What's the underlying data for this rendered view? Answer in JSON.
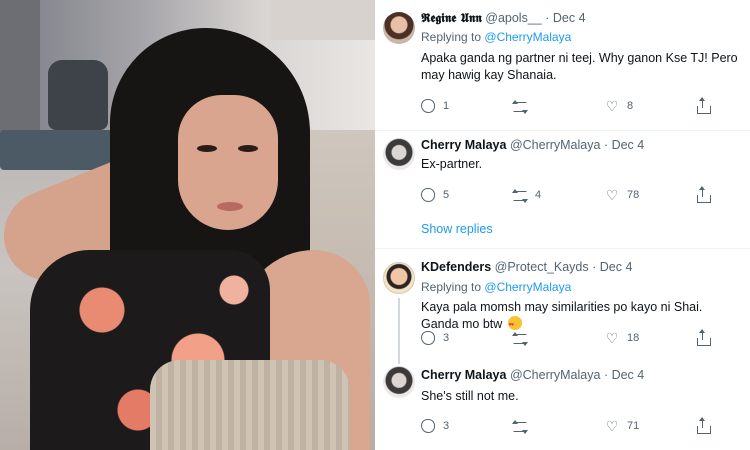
{
  "photo": {
    "description_icon": "portrait-photo"
  },
  "tweets": [
    {
      "name": "𝕽𝖊𝖌𝖎𝖓𝖊 𝖀𝖓𝖓",
      "handle": "@apols__",
      "date": "· Dec 4",
      "replying_label": "Replying to",
      "replying_handle": "@CherryMalaya",
      "text": "Apaka ganda ng partner ni teej. Why ganon Kse TJ! Pero may hawig kay Shanaia.",
      "replies": "1",
      "retweets": "",
      "likes": "8"
    },
    {
      "name": "Cherry Malaya",
      "handle": "@CherryMalaya",
      "date": "· Dec 4",
      "text": "Ex-partner.",
      "replies": "5",
      "retweets": "4",
      "likes": "78",
      "show_replies": "Show replies"
    },
    {
      "name": "KDefenders",
      "handle": "@Protect_Kayds",
      "date": "· Dec 4",
      "replying_label": "Replying to",
      "replying_handle": "@CherryMalaya",
      "text": "Kaya pala momsh may similarities po kayo ni Shai. Ganda mo btw",
      "replies": "3",
      "retweets": "",
      "likes": "18"
    },
    {
      "name": "Cherry Malaya",
      "handle": "@CherryMalaya",
      "date": "· Dec 4",
      "text": "She's still not me.",
      "replies": "3",
      "retweets": "",
      "likes": "71"
    }
  ],
  "icons": {
    "reply": "reply-icon",
    "retweet": "retweet-icon",
    "like": "heart-icon",
    "share": "share-icon",
    "emoji": "heart-eyes-emoji"
  },
  "colors": {
    "link": "#1d9bf0",
    "text": "#0f1419",
    "muted": "#536471"
  }
}
